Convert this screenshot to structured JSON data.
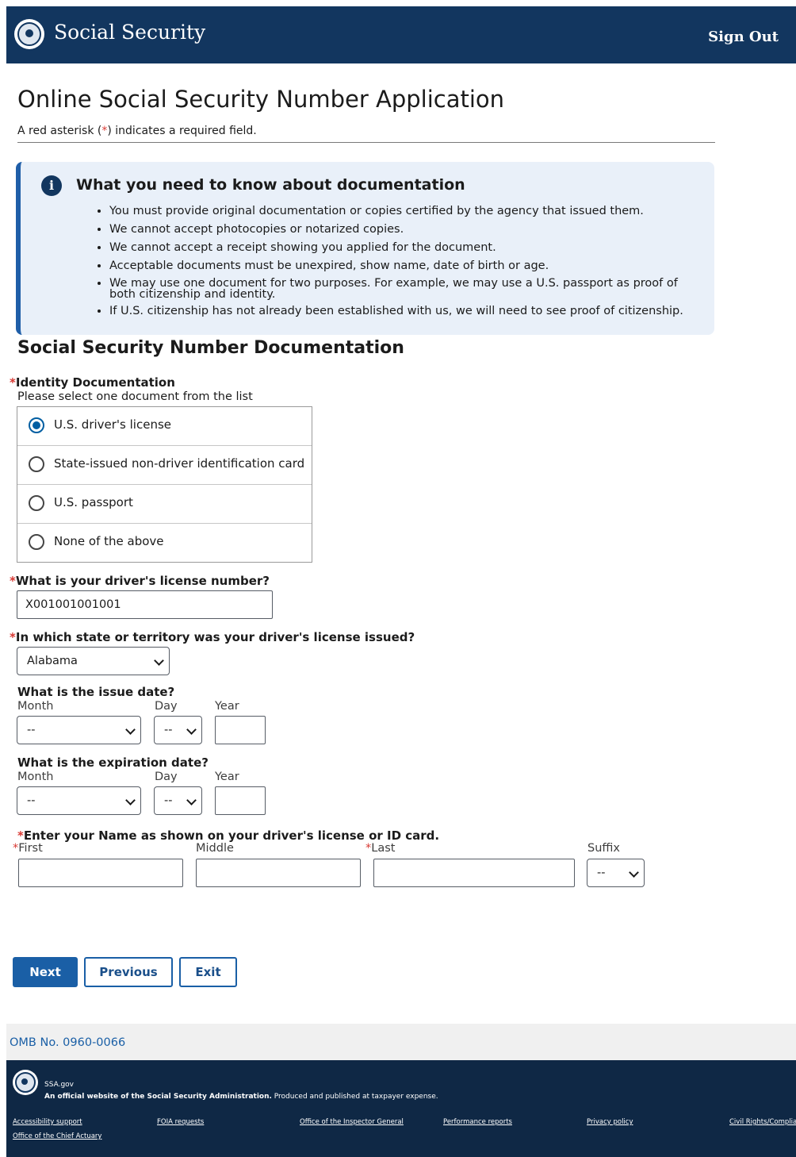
{
  "header": {
    "brand": "Social Security",
    "sign_out": "Sign Out"
  },
  "page": {
    "title": "Online Social Security Number Application",
    "required_note_prefix": "A red asterisk (",
    "required_note_star": "*",
    "required_note_suffix": ") indicates a required field."
  },
  "info_box": {
    "icon": "i",
    "title": "What you need to know about documentation",
    "items": [
      "You must provide original documentation or copies certified by the agency that issued them.",
      "We cannot accept photocopies or notarized copies.",
      "We cannot accept a receipt showing you applied for the document.",
      "Acceptable documents must be unexpired, show name, date of birth or age.",
      "We may use one document for two purposes. For example, we may use a U.S. passport as proof of both citizenship and identity.",
      "If U.S. citizenship has not already been established with us, we will need to see proof of citizenship."
    ]
  },
  "section": {
    "title": "Social Security Number Documentation"
  },
  "asterisk": "*",
  "identity": {
    "label": "Identity Documentation",
    "hint": "Please select one document from the list",
    "options": [
      {
        "label": "U.S. driver's license",
        "selected": true
      },
      {
        "label": "State-issued non-driver identification card",
        "selected": false
      },
      {
        "label": "U.S. passport",
        "selected": false
      },
      {
        "label": "None of the above",
        "selected": false
      }
    ]
  },
  "license_number": {
    "label": "What is your driver's license number?",
    "value": "X001001001001"
  },
  "license_state": {
    "label": "In which state or territory was your driver's license issued?",
    "value": "Alabama"
  },
  "issue_date": {
    "label": "What is the issue date?",
    "month_label": "Month",
    "day_label": "Day",
    "year_label": "Year",
    "month_value": "--",
    "day_value": "--",
    "year_value": ""
  },
  "expiration_date": {
    "label": "What is the expiration date?",
    "month_label": "Month",
    "day_label": "Day",
    "year_label": "Year",
    "month_value": "--",
    "day_value": "--",
    "year_value": ""
  },
  "name": {
    "label": "Enter your Name as shown on your driver's license or ID card.",
    "first_label": "First",
    "middle_label": "Middle",
    "last_label": "Last",
    "suffix_label": "Suffix",
    "suffix_value": "--"
  },
  "buttons": {
    "next": "Next",
    "previous": "Previous",
    "exit": "Exit"
  },
  "omb": "OMB No. 0960-0066",
  "footer": {
    "site": "SSA.gov",
    "official_bold": "An official website of the Social Security Administration.",
    "official_rest": " Produced and published at taxpayer expense.",
    "links": [
      "Accessibility support",
      "FOIA requests",
      "Office of the Inspector General",
      "Performance reports",
      "Privacy policy",
      "Civil Rights/Compliance",
      "Office of the Chief Actuary"
    ]
  },
  "colors": {
    "header": "#12365f",
    "accent": "#1a5fa6",
    "required": "#d83933",
    "info_bg": "#e9f0f9",
    "footer": "#0f2845"
  }
}
